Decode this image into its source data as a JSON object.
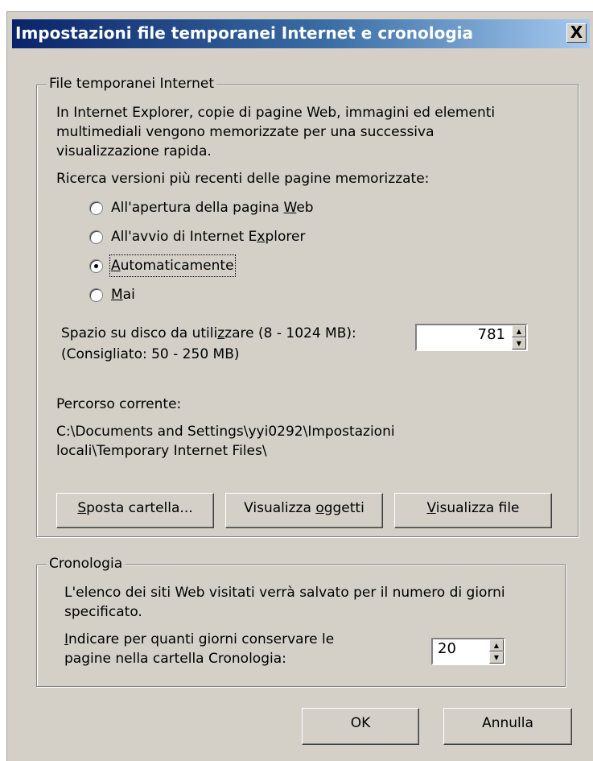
{
  "window": {
    "title": "Impostazioni file temporanei Internet e cronologia",
    "close_glyph": "X"
  },
  "temp_files": {
    "legend": "File temporanei Internet",
    "description": [
      "In Internet Explorer, copie di pagine Web, immagini ed elementi",
      "multimediali vengono memorizzate per una successiva",
      "visualizzazione rapida."
    ],
    "check_label": "Ricerca versioni più recenti delle pagine memorizzate:",
    "options": [
      {
        "label": "All'apertura della pagina Web",
        "selected": false
      },
      {
        "label": "All'avvio di Internet Explorer",
        "selected": false
      },
      {
        "label": "Automaticamente",
        "selected": true
      },
      {
        "label": "Mai",
        "selected": false
      }
    ],
    "disk_label": "Spazio su disco da utilizzare (8 - 1024 MB):",
    "disk_hint": "(Consigliato: 50 - 250 MB)",
    "disk_value": "781",
    "path_label": "Percorso corrente:",
    "path_lines": [
      "C:\\Documents and Settings\\yyi0292\\Impostazioni",
      "locali\\Temporary Internet Files\\"
    ],
    "buttons": {
      "move": "Sposta cartella...",
      "view_objects": "Visualizza oggetti",
      "view_files": "Visualizza file"
    }
  },
  "history": {
    "legend": "Cronologia",
    "description": [
      "L'elenco dei siti Web visitati verrà salvato per il numero di giorni",
      "specificato."
    ],
    "days_label": [
      "Indicare per quanti giorni conservare le",
      "pagine nella cartella Cronologia:"
    ],
    "days_value": "20"
  },
  "footer": {
    "ok": "OK",
    "cancel": "Annulla"
  }
}
